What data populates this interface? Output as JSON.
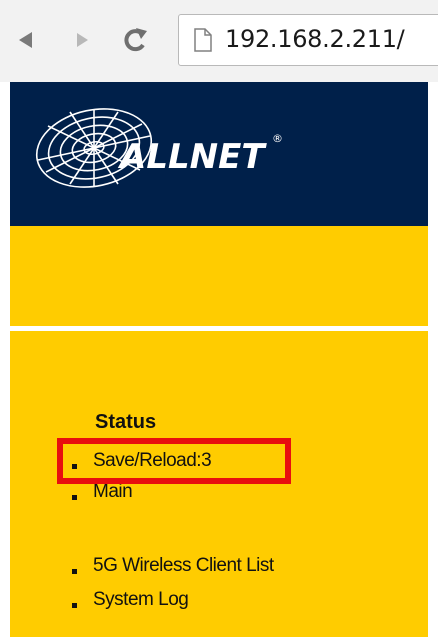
{
  "browser": {
    "url": "192.168.2.211/",
    "back_icon": "back-arrow-icon",
    "forward_icon": "forward-arrow-icon",
    "reload_icon": "reload-icon",
    "page_icon": "page-icon"
  },
  "header": {
    "logo_text": "ALLNET",
    "logo_mark": "®",
    "background": "#00204a"
  },
  "menu": {
    "title": "Status",
    "items": [
      {
        "label": "Save/Reload:3",
        "highlighted": true
      },
      {
        "label": "Main"
      },
      {
        "label": "5G Wireless Client List"
      },
      {
        "label": "System Log"
      }
    ]
  },
  "colors": {
    "accent_yellow": "#ffcc00",
    "highlight_red": "#e80e0e"
  }
}
